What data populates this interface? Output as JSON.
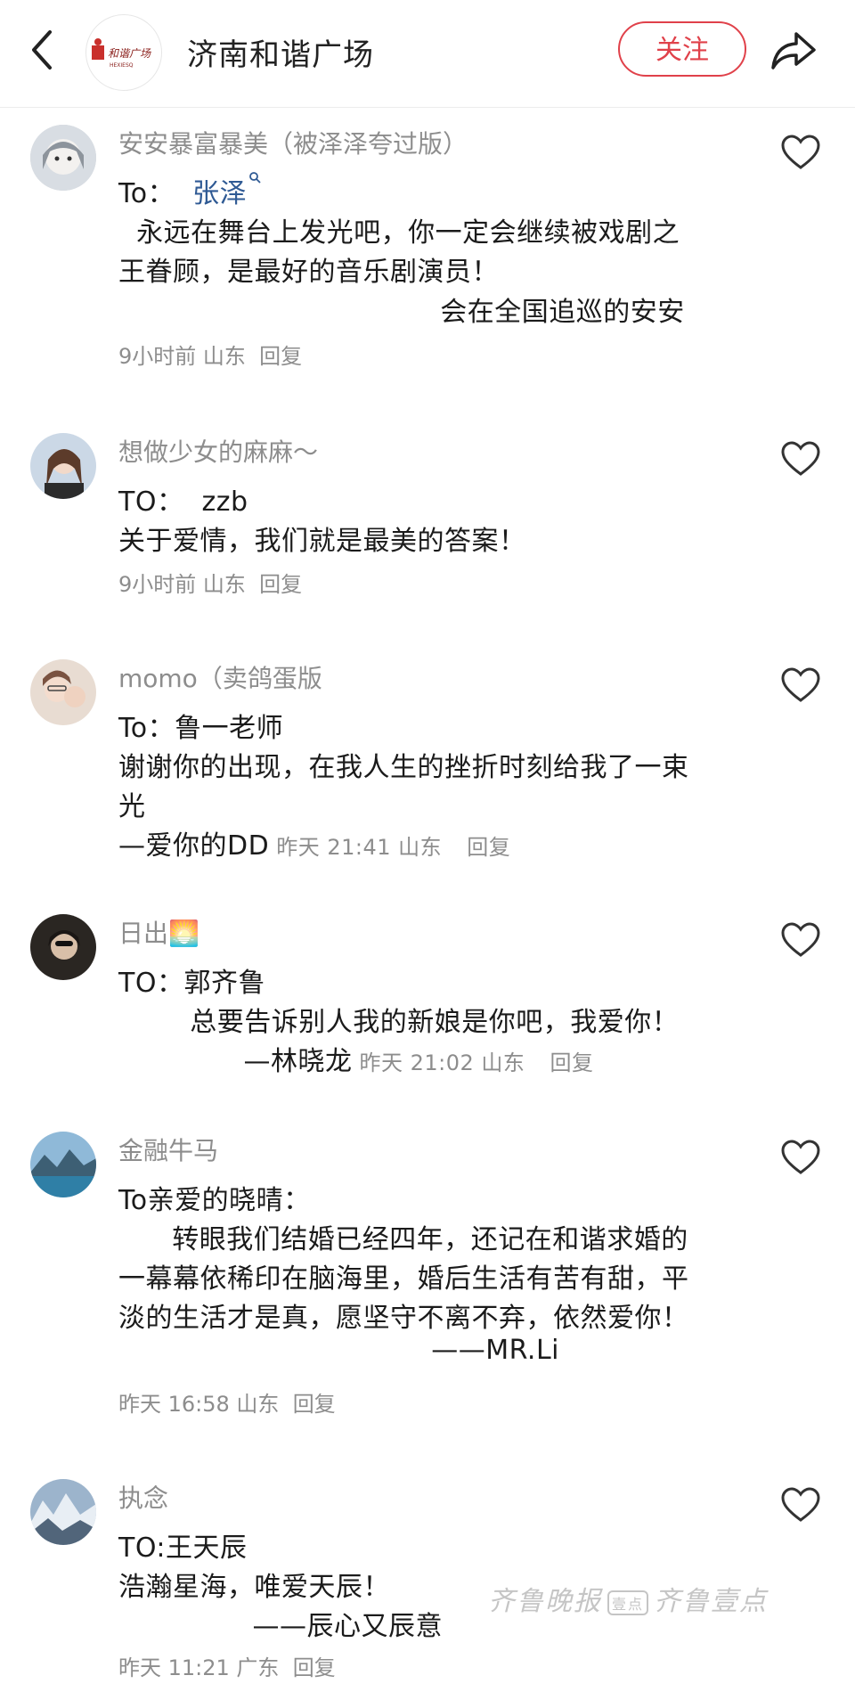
{
  "header": {
    "title": "济南和谐广场",
    "follow_label": "关注",
    "logo_text": "和谐广场",
    "logo_subtext": "HEXIESQ"
  },
  "colors": {
    "accent": "#e0414a",
    "link": "#2f5a94",
    "meta": "#8d8d8d"
  },
  "comments": [
    {
      "username": "安安暴富暴美（被泽泽夸过版）",
      "to_prefix": "To：  ",
      "to_name": "张泽",
      "lines": [
        "  永远在舞台上发光吧，你一定会继续被戏剧之",
        "王眷顾，是最好的音乐剧演员！",
        "                                    会在全国追巡的安安"
      ],
      "meta": "9小时前 山东",
      "reply": "回复"
    },
    {
      "username": "想做少女的麻麻～",
      "lines": [
        "TO：  zzb",
        "关于爱情，我们就是最美的答案！"
      ],
      "meta": "9小时前 山东",
      "reply": "回复"
    },
    {
      "username": "momo（卖鸽蛋版",
      "lines": [
        "To：鲁一老师",
        "谢谢你的出现，在我人生的挫折时刻给我了一束",
        "光"
      ],
      "last_line": "—爱你的DD",
      "meta": "昨天 21:41 山东",
      "reply": "回复"
    },
    {
      "username": "日出",
      "username_emoji": "🌅",
      "lines": [
        "TO：郭齐鲁",
        "        总要告诉别人我的新娘是你吧，我爱你！"
      ],
      "last_line": "              —林晓龙",
      "meta": "昨天 21:02 山东",
      "reply": "回复"
    },
    {
      "username": "金融牛马",
      "lines": [
        "To亲爱的晓晴：",
        "      转眼我们结婚已经四年，还记在和谐求婚的",
        "一幕幕依稀印在脑海里，婚后生活有苦有甜，平",
        "淡的生活才是真，愿坚守不离不弃，依然爱你！",
        "                                   ——MR.Li"
      ],
      "meta": "昨天 16:58 山东",
      "reply": "回复"
    },
    {
      "username": "执念",
      "lines": [
        "TO:王天辰",
        "浩瀚星海，唯爱天辰！",
        "               ——辰心又辰意"
      ],
      "meta": "昨天 11:21 广东",
      "reply": "回复"
    }
  ],
  "watermark": {
    "left": "齐鲁晚报",
    "box": "壹点",
    "right": "齐鲁壹点"
  }
}
